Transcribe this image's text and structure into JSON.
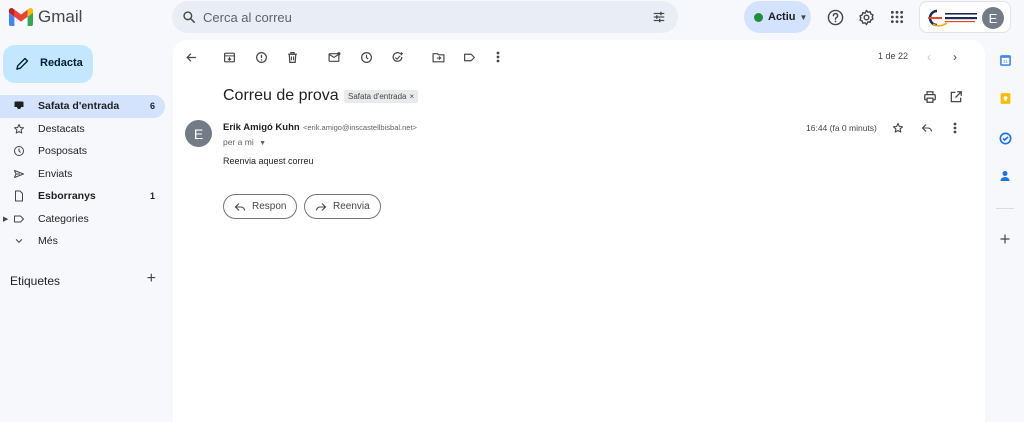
{
  "app": {
    "name": "Gmail"
  },
  "search": {
    "placeholder": "Cerca al correu"
  },
  "status": {
    "label": "Actiu",
    "color": "#1e8e3e"
  },
  "account": {
    "avatar_letter": "E",
    "org_logo_text": "INSTITUT CASTELLBISBAL"
  },
  "compose": {
    "label": "Redacta"
  },
  "nav": [
    {
      "label": "Safata d'entrada",
      "count": "6",
      "icon": "inbox-icon",
      "active": true,
      "bold": true
    },
    {
      "label": "Destacats",
      "count": "",
      "icon": "star-icon"
    },
    {
      "label": "Posposats",
      "count": "",
      "icon": "clock-icon"
    },
    {
      "label": "Enviats",
      "count": "",
      "icon": "send-icon"
    },
    {
      "label": "Esborranys",
      "count": "1",
      "icon": "draft-icon",
      "bold": true
    },
    {
      "label": "Categories",
      "count": "",
      "icon": "label-icon"
    },
    {
      "label": "Més",
      "count": "",
      "icon": "chevron-down-icon"
    }
  ],
  "labels": {
    "title": "Etiquetes"
  },
  "toolbar": {
    "pager": "1 de 22"
  },
  "message": {
    "subject": "Correu de prova",
    "label_chip": "Safata d'entrada",
    "chip_close": "×",
    "sender_name": "Erik Amigó Kuhn",
    "sender_email": "<erik.amigo@inscastellbisbal.net>",
    "recipient": "per a mi",
    "time": "16:44 (fa 0 minuts)",
    "avatar_letter": "E",
    "body": "Reenvia aquest correu"
  },
  "actions": {
    "reply": "Respon",
    "forward": "Reenvia"
  },
  "colors": {
    "accent": "#0b57d0",
    "compose_bg": "#c2e7ff",
    "active_nav": "#d3e3fd",
    "gmail_red": "#ea4335"
  }
}
